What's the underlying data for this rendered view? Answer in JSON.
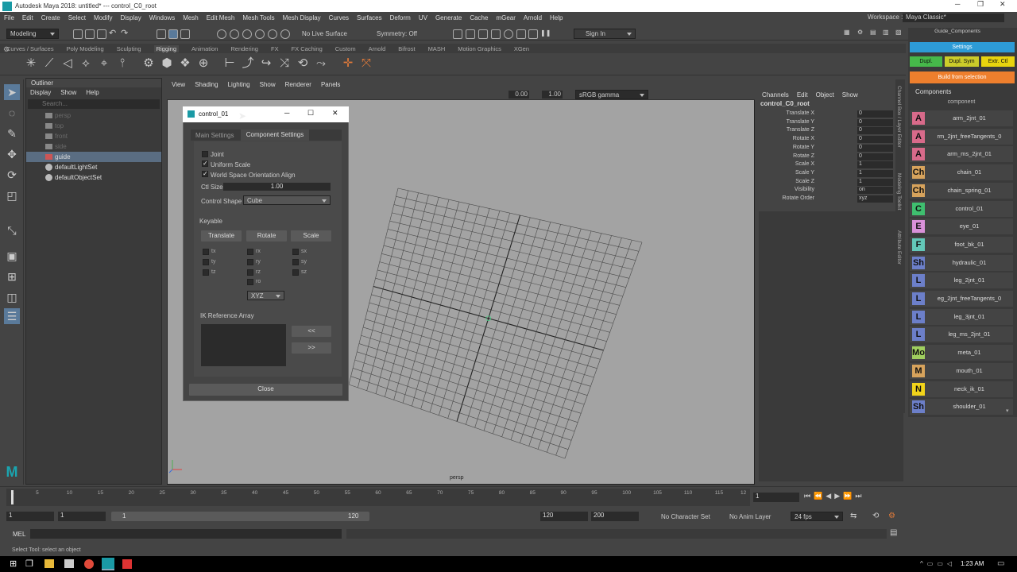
{
  "app": {
    "title": "Autodesk Maya 2018: untitled*   ---   control_C0_root"
  },
  "menubar": {
    "items": [
      "File",
      "Edit",
      "Create",
      "Select",
      "Modify",
      "Display",
      "Windows",
      "Mesh",
      "Edit Mesh",
      "Mesh Tools",
      "Mesh Display",
      "Curves",
      "Surfaces",
      "Deform",
      "UV",
      "Generate",
      "Cache",
      "mGear",
      "Arnold",
      "Help"
    ],
    "workspace_label": "Workspace :",
    "workspace_value": "Maya Classic*"
  },
  "statusline": {
    "mode": "Modeling",
    "live_surface": "No Live Surface",
    "symmetry": "Symmetry: Off",
    "signin": "Sign In"
  },
  "shelf": {
    "tabs": [
      "Curves / Surfaces",
      "Poly Modeling",
      "Sculpting",
      "Rigging",
      "Animation",
      "Rendering",
      "FX",
      "FX Caching",
      "Custom",
      "Arnold",
      "Bifrost",
      "MASH",
      "Motion Graphics",
      "XGen"
    ],
    "active_tab": "Rigging"
  },
  "outliner": {
    "title": "Outliner",
    "menu": [
      "Display",
      "Show",
      "Help"
    ],
    "search_placeholder": "Search...",
    "items": [
      {
        "label": "persp",
        "dim": true
      },
      {
        "label": "top",
        "dim": true
      },
      {
        "label": "front",
        "dim": true
      },
      {
        "label": "side",
        "dim": true
      },
      {
        "label": "guide",
        "dim": false,
        "selected": true
      },
      {
        "label": "defaultLightSet",
        "dim": false
      },
      {
        "label": "defaultObjectSet",
        "dim": false
      }
    ]
  },
  "viewport": {
    "menu": [
      "View",
      "Shading",
      "Lighting",
      "Show",
      "Renderer",
      "Panels"
    ],
    "exposure": "0.00",
    "gamma": "1.00",
    "colorspace": "sRGB gamma",
    "camera": "persp"
  },
  "dialog": {
    "title": "control_01",
    "tab_main": "Main Settings",
    "tab_component": "Component Settings",
    "joint_label": "Joint",
    "joint_checked": false,
    "uniform_label": "Uniform Scale",
    "uniform_checked": true,
    "wsoa_label": "World Space Orientation Align",
    "wsoa_checked": true,
    "ctlsize_label": "Ctl Size",
    "ctlsize_value": "1.00",
    "shape_label": "Control Shape",
    "shape_value": "Cube",
    "keyable_label": "Keyable",
    "btn_translate": "Translate",
    "btn_rotate": "Rotate",
    "btn_scale": "Scale",
    "keys_t": [
      "tx",
      "ty",
      "tz"
    ],
    "keys_r": [
      "rx",
      "ry",
      "rz",
      "ro"
    ],
    "keys_s": [
      "sx",
      "sy",
      "sz"
    ],
    "order_value": "XYZ",
    "ikref_label": "IK Reference Array",
    "btn_add": "<<",
    "btn_remove": ">>",
    "close": "Close"
  },
  "channelbox": {
    "menu": [
      "Channels",
      "Edit",
      "Object",
      "Show"
    ],
    "node": "control_C0_root",
    "channels": [
      {
        "name": "Translate X",
        "value": "0"
      },
      {
        "name": "Translate Y",
        "value": "0"
      },
      {
        "name": "Translate Z",
        "value": "0"
      },
      {
        "name": "Rotate X",
        "value": "0"
      },
      {
        "name": "Rotate Y",
        "value": "0"
      },
      {
        "name": "Rotate Z",
        "value": "0"
      },
      {
        "name": "Scale X",
        "value": "1"
      },
      {
        "name": "Scale Y",
        "value": "1"
      },
      {
        "name": "Scale Z",
        "value": "1"
      },
      {
        "name": "Visibility",
        "value": "on"
      },
      {
        "name": "Rotate Order",
        "value": "xyz"
      }
    ],
    "side_tabs": [
      "Channel Box / Layer Editor",
      "Modeling Toolkit",
      "Attribute Editor"
    ]
  },
  "components": {
    "window_title": "Guide_Components",
    "settings": "Settings",
    "dupl": "Dupl.",
    "dupl_sym": "Dupl. Sym",
    "extr_ctl": "Extr. Ctl",
    "build": "Build from selection",
    "header": "Components",
    "col_header": "component",
    "items": [
      {
        "badge": "A",
        "name": "arm_2jnt_01",
        "color": "#d86a8a"
      },
      {
        "badge": "A",
        "name": "rm_2jnt_freeTangents_0",
        "color": "#d86a8a"
      },
      {
        "badge": "A",
        "name": "arm_ms_2jnt_01",
        "color": "#d86a8a"
      },
      {
        "badge": "Ch",
        "name": "chain_01",
        "color": "#d7a35c"
      },
      {
        "badge": "Ch",
        "name": "chain_spring_01",
        "color": "#d7a35c"
      },
      {
        "badge": "C",
        "name": "control_01",
        "color": "#3fbf6f"
      },
      {
        "badge": "E",
        "name": "eye_01",
        "color": "#d991d9"
      },
      {
        "badge": "F",
        "name": "foot_bk_01",
        "color": "#63c7b8"
      },
      {
        "badge": "Sh",
        "name": "hydraulic_01",
        "color": "#6c7fc9"
      },
      {
        "badge": "L",
        "name": "leg_2jnt_01",
        "color": "#6c7fc9"
      },
      {
        "badge": "L",
        "name": "eg_2jnt_freeTangents_0",
        "color": "#6c7fc9"
      },
      {
        "badge": "L",
        "name": "leg_3jnt_01",
        "color": "#6c7fc9"
      },
      {
        "badge": "L",
        "name": "leg_ms_2jnt_01",
        "color": "#6c7fc9"
      },
      {
        "badge": "Mo",
        "name": "meta_01",
        "color": "#a0cf5f"
      },
      {
        "badge": "M",
        "name": "mouth_01",
        "color": "#d7a35c"
      },
      {
        "badge": "N",
        "name": "neck_ik_01",
        "color": "#f2d41a"
      },
      {
        "badge": "Sh",
        "name": "shoulder_01",
        "color": "#6c7fc9"
      }
    ]
  },
  "timeline": {
    "ticks": [
      "1",
      "5",
      "10",
      "15",
      "20",
      "25",
      "30",
      "35",
      "40",
      "45",
      "50",
      "55",
      "60",
      "65",
      "70",
      "75",
      "80",
      "85",
      "90",
      "95",
      "100",
      "105",
      "110",
      "115",
      "12"
    ],
    "current": "1"
  },
  "range": {
    "start": "1",
    "start2": "1",
    "slider_start": "1",
    "slider_end": "120",
    "end": "120",
    "end2": "200",
    "charset": "No Character Set",
    "animlayer": "No Anim Layer",
    "fps": "24 fps"
  },
  "mel": {
    "label": "MEL"
  },
  "help": {
    "text": "Select Tool: select an object"
  },
  "taskbar": {
    "time": "1:23 AM"
  }
}
